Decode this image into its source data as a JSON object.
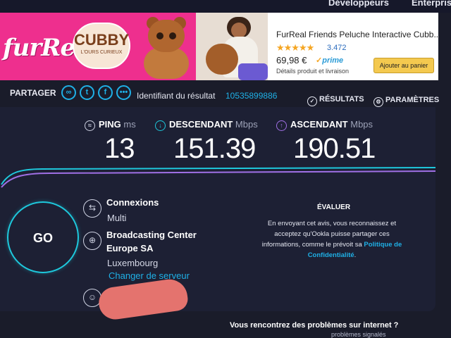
{
  "nav": {
    "developers": "Développeurs",
    "enterprise": "Enterpris"
  },
  "ad": {
    "brand_logo": "furReal",
    "cubby_title": "CUBBY",
    "cubby_subtitle": "L'OURS CURIEUX",
    "product_name": "FurReal Friends Peluche Interactive Cubb...",
    "stars": "★★★★★",
    "rating_count": "3.472",
    "price": "69,98 €",
    "prime": "prime",
    "details": "Détails produit et livraison",
    "cart_button": "Ajouter au panier"
  },
  "share": {
    "label": "PARTAGER",
    "icons": [
      "link-icon",
      "twitter-icon",
      "facebook-icon",
      "more-icon"
    ],
    "result_label": "Identifiant du résultat",
    "result_id": "10535899886",
    "results_link": "RÉSULTATS",
    "settings_link": "PARAMÈTRES"
  },
  "metrics": {
    "ping": {
      "label": "PING",
      "unit": "ms",
      "value": "13"
    },
    "download": {
      "label": "DESCENDANT",
      "unit": "Mbps",
      "value": "151.39"
    },
    "upload": {
      "label": "ASCENDANT",
      "unit": "Mbps",
      "value": "190.51"
    }
  },
  "colors": {
    "accent_cyan": "#1ec8dc",
    "accent_purple": "#a070e6",
    "link_blue": "#1fb0e6",
    "ad_pink": "#ee2f8e"
  },
  "go": {
    "label": "GO"
  },
  "connections": {
    "title": "Connexions",
    "value": "Multi"
  },
  "server": {
    "name_line1": "Broadcasting Center",
    "name_line2": "Europe SA",
    "location": "Luxembourg",
    "change_link": "Changer de serveur"
  },
  "evaluate": {
    "title": "ÉVALUER",
    "line1": "En envoyant cet avis, vous reconnaissez et",
    "line2": "acceptez qu'Ookla puisse partager ces",
    "line3": "informations, comme le prévoit sa",
    "link1": "Politique de",
    "link2": "Confidentialité",
    "period": "."
  },
  "footer": {
    "problems": "Vous rencontrez des problèmes sur internet ?",
    "problems_sub": "problèmes signalés"
  }
}
